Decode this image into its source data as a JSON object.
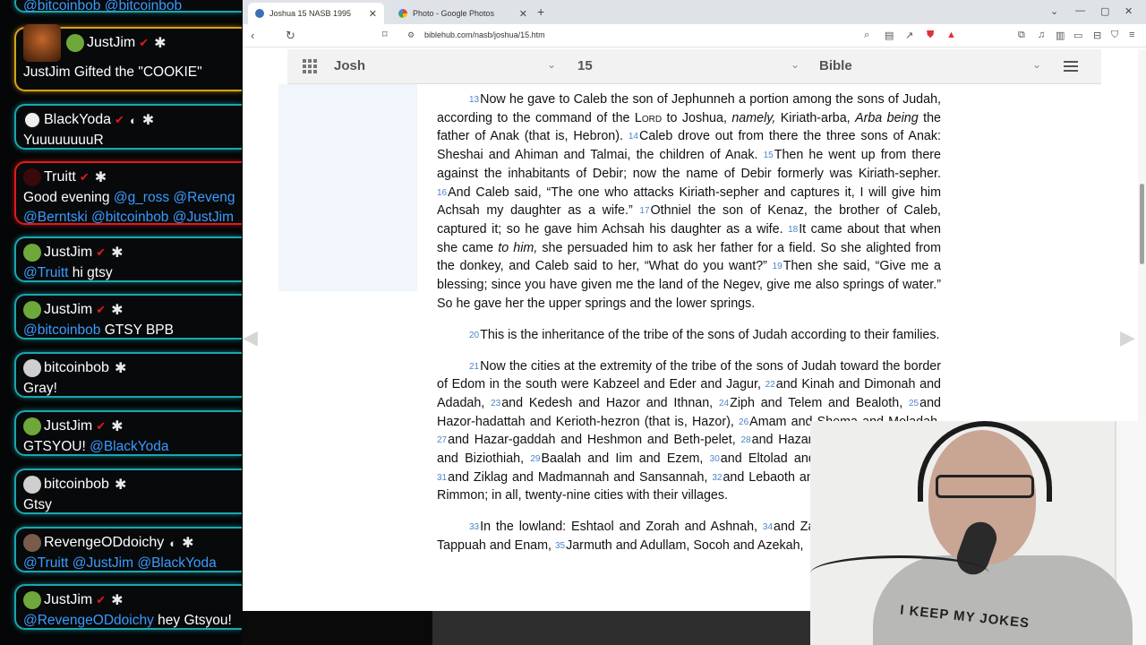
{
  "chat": {
    "top_partial": "@bitcoinbob @bitcoinbob",
    "messages": [
      {
        "user": "JustJim",
        "text": "JustJim Gifted the \"COOKIE\""
      },
      {
        "user": "BlackYoda",
        "text": "YuuuuuuuuR"
      },
      {
        "user": "Truitt",
        "text_prefix": "Good evening ",
        "mention_1": "@g_ross @Revenge",
        "line2": "@Berntski @bitcoinbob @JustJim"
      },
      {
        "user": "JustJim",
        "mention": "@Truitt",
        "text": " hi gtsy"
      },
      {
        "user": "JustJim",
        "mention": "@bitcoinbob",
        "text": " GTSY BPB"
      },
      {
        "user": "bitcoinbob",
        "text": "Gray!"
      },
      {
        "user": "JustJim",
        "text": "GTSYOU! ",
        "mention": "@BlackYoda"
      },
      {
        "user": "bitcoinbob",
        "text": "Gtsy"
      },
      {
        "user": "RevengeODdoichy",
        "mention": "@Truitt @JustJim @BlackYoda"
      },
      {
        "user": "JustJim",
        "mention": "@RevengeODdoichy",
        "text": " hey Gtsyou!"
      }
    ]
  },
  "browser": {
    "tabs": [
      {
        "title": "Joshua 15 NASB 1995",
        "active": true
      },
      {
        "title": "Photo - Google Photos",
        "active": false
      }
    ],
    "new_tab": "+",
    "url": "biblehub.com/nasb/joshua/15.htm"
  },
  "biblebar": {
    "book": "Josh",
    "chapter": "15",
    "version": "Bible"
  },
  "scripture": {
    "p1": {
      "v13": "13",
      "t13a": "Now he gave to Caleb the son of Jephunneh a portion among the sons of Judah, according to the command of the ",
      "lord": "Lord",
      "t13b": " to Joshua, ",
      "namely": "namely,",
      "t13c": " Kiriath-arba, ",
      "arba_being": "Arba being",
      "t13d": " the father of Anak (that is, Hebron). ",
      "v14": "14",
      "t14": "Caleb drove out from there the three sons of Anak: Sheshai and Ahiman and Talmai, the children of Anak. ",
      "v15": "15",
      "t15": "Then he went up from there against the inhabitants of Debir; now the name of Debir formerly was Kiriath-sepher. ",
      "v16": "16",
      "t16": "And Caleb said, “The one who attacks Kiriath-sepher and captures it, I will give him Achsah my daughter as a wife.” ",
      "v17": "17",
      "t17": "Othniel the son of Kenaz, the brother of Caleb, captured it; so he gave him Achsah his daughter as a wife. ",
      "v18": "18",
      "t18a": "It came about that when she came ",
      "to_him": "to him,",
      "t18b": " she persuaded him to ask her father for a field. So she alighted from the donkey, and Caleb said to her, “What do you want?” ",
      "v19": "19",
      "t19": "Then she said, “Give me a blessing; since you have given me the land of the Negev, give me also springs of water.” So he gave her the upper springs and the lower springs."
    },
    "p2": {
      "v20": "20",
      "t20": "This is the inheritance of the tribe of the sons of Judah according to their families."
    },
    "p3": {
      "v21": "21",
      "t21": "Now the cities at the extremity of the tribe of the sons of Judah toward the border of Edom in the south were Kabzeel and Eder and Jagur, ",
      "v22": "22",
      "t22": "and Kinah and Dimonah and Adadah, ",
      "v23": "23",
      "t23": "and Kedesh and Hazor and Ithnan, ",
      "v24": "24",
      "t24": "Ziph and Telem and Bealoth, ",
      "v25": "25",
      "t25": "and Hazor-hadattah and Kerioth-hezron (that is, Hazor), ",
      "v26": "26",
      "t26": "Amam and Shema and Moladah, ",
      "v27": "27",
      "t27": "and Hazar-gaddah and Heshmon and Beth-pelet, ",
      "v28": "28",
      "t28": "and Hazar-shual and Beersheba and Biziothiah, ",
      "v29": "29",
      "t29": "Baalah and Iim and Ezem, ",
      "v30": "30",
      "t30": "and Eltolad and Chesil and Hormah, ",
      "v31": "31",
      "t31": "and Ziklag and Madmannah and Sansannah, ",
      "v32": "32",
      "t32": "and Lebaoth and Shilhim and Ain and Rimmon; in all, twenty-nine cities with their villages."
    },
    "p4": {
      "v33": "33",
      "t33": "In the lowland: Eshtaol and Zorah and Ashnah, ",
      "v34": "34",
      "t34": "and Zanoah and En-gannim, Tappuah and Enam, ",
      "v35": "35",
      "t35": "Jarmuth and Adullam, Socoh and Azekah,"
    }
  },
  "webcam": {
    "shirt_text": "I KEEP MY JOKES"
  },
  "colors": {
    "accent_blue": "#4a86c9",
    "chat_cyan": "#1aa6b0",
    "chat_red": "#e01a1a",
    "chat_gold": "#d6a21b",
    "mention": "#3b9bff"
  }
}
